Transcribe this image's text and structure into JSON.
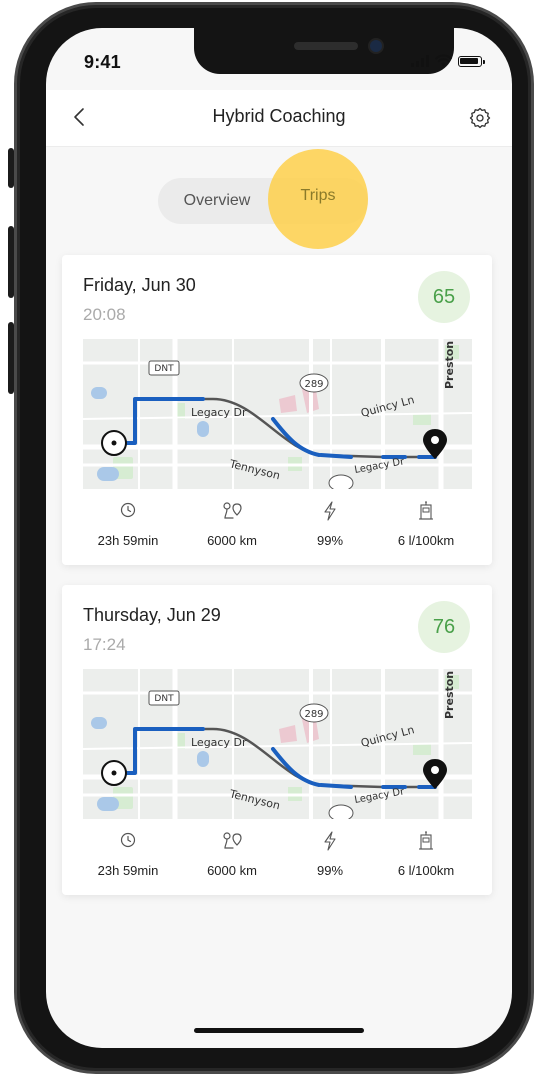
{
  "status_bar": {
    "time": "9:41"
  },
  "header": {
    "title": "Hybrid Coaching"
  },
  "tabs": {
    "overview": "Overview",
    "trips": "Trips"
  },
  "trips": [
    {
      "date": "Friday, Jun 30",
      "time": "20:08",
      "score": "65",
      "stats": {
        "duration": "23h 59min",
        "distance": "6000 km",
        "battery": "99%",
        "fuel": "6 l/100km"
      }
    },
    {
      "date": "Thursday, Jun 29",
      "time": "17:24",
      "score": "76",
      "stats": {
        "duration": "23h 59min",
        "distance": "6000 km",
        "battery": "99%",
        "fuel": "6 l/100km"
      }
    }
  ],
  "map_labels": {
    "dnt": "DNT",
    "legacy": "Legacy Dr",
    "quincy": "Quincy Ln",
    "tennyson": "Tennyson",
    "preston": "Preston",
    "route289": "289",
    "legacy2": "Legacy Dr"
  },
  "colors": {
    "route": "#1a5fbf",
    "score_bg": "#e6f3e0",
    "score_text": "#4aa04a",
    "highlight": "#ffcd3c"
  }
}
